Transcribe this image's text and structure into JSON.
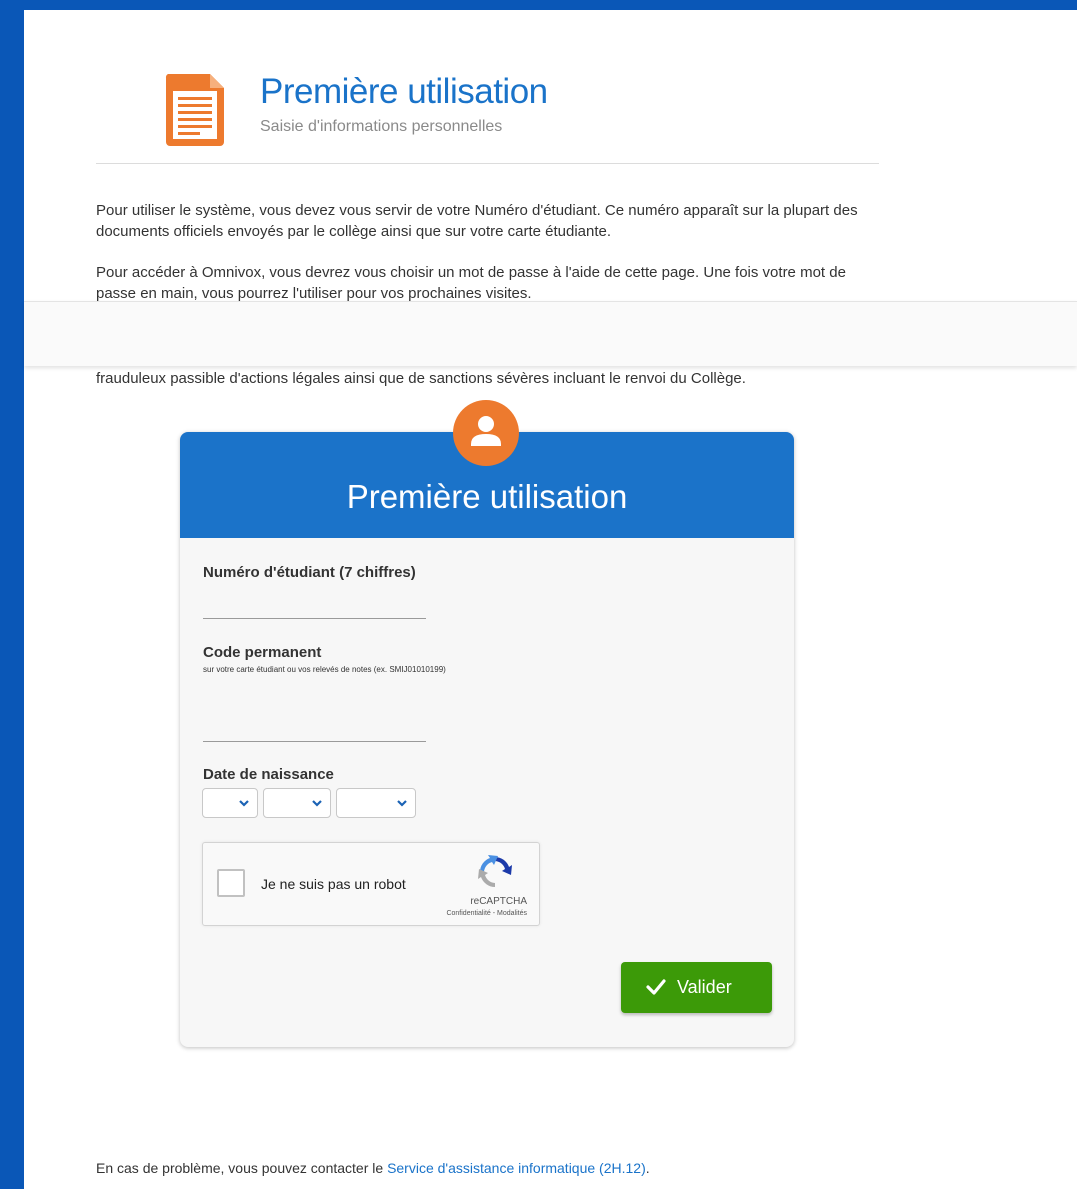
{
  "header": {
    "title": "Première utilisation",
    "subtitle": "Saisie d'informations personnelles",
    "icon": "document-icon",
    "icon_color": "#ed7a2e"
  },
  "intro": {
    "paragraph_1": "Pour utiliser le système, vous devez vous servir de votre Numéro d'étudiant. Ce numéro apparaît sur la plupart des documents officiels envoyés par le collège ainsi que sur votre carte étudiante.",
    "paragraph_2": "Pour accéder à Omnivox, vous devrez vous choisir un mot de passe à l'aide de cette page. Une fois votre mot de passe en main, vous pourrez l'utiliser pour vos prochaines visites.",
    "paragraph_3": "frauduleux passible d'actions légales ainsi que de sanctions sévères incluant le renvoi du Collège."
  },
  "form": {
    "title": "Première utilisation",
    "avatar_icon": "user-icon",
    "student_number": {
      "label": "Numéro d'étudiant (7 chiffres)",
      "value": ""
    },
    "permanent_code": {
      "label": "Code permanent",
      "hint": "sur votre carte étudiant ou vos relevés de notes (ex. SMIJ01010199)",
      "value": ""
    },
    "birth_date": {
      "label": "Date de naissance",
      "day": "",
      "month": "",
      "year": ""
    },
    "recaptcha": {
      "label": "Je ne suis pas un robot",
      "brand": "reCAPTCHA",
      "terms": "Confidentialité - Modalités"
    },
    "submit_label": "Valider"
  },
  "footer": {
    "text": "En cas de problème, vous pouvez contacter le ",
    "link": "Service d'assistance informatique (2H.12)",
    "suffix": "."
  },
  "colors": {
    "brand_blue": "#1b73c9",
    "frame_blue": "#0a57b7",
    "accent_orange": "#ed7a2e",
    "submit_green": "#3c9a08"
  }
}
